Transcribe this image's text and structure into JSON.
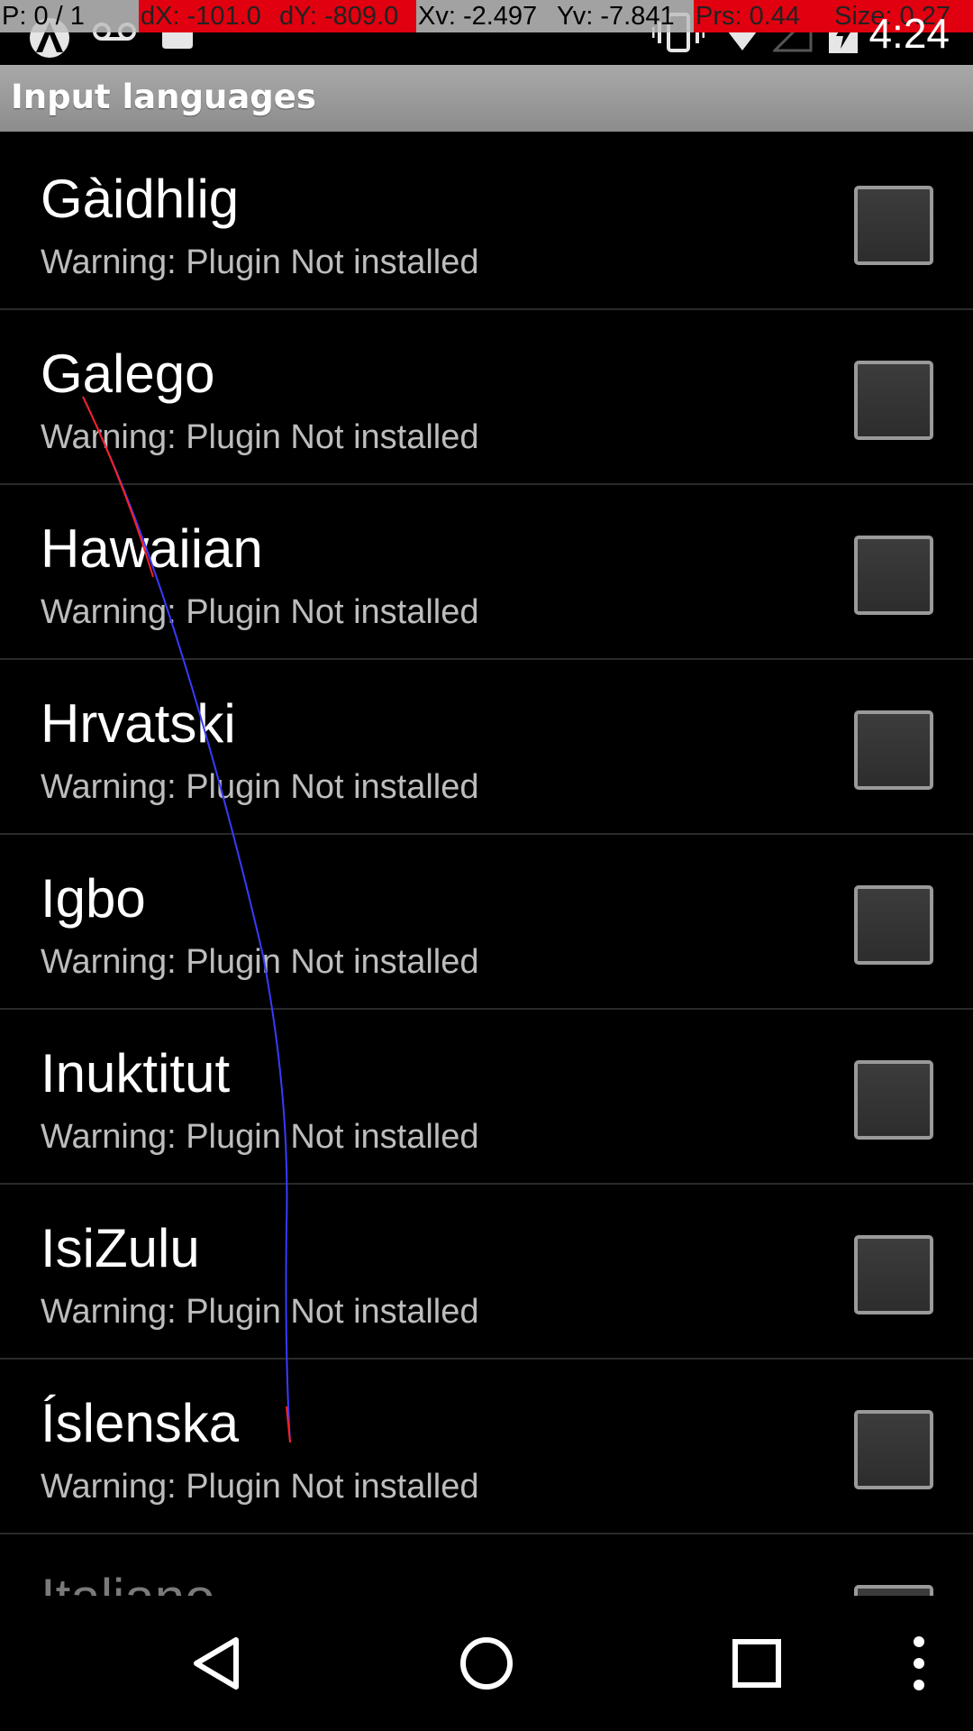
{
  "debug": {
    "pointer": "P: 0 / 1",
    "dx": "dX: -101.0",
    "dy": "dY: -809.0",
    "xv": "Xv: -2.497",
    "yv": "Yv: -7.841",
    "prs": "Prs: 0.44",
    "size": "Size: 0.27"
  },
  "status_bar": {
    "time": "4:24",
    "icons": [
      "android-icon",
      "voicemail-icon",
      "sd-card-icon",
      "vibrate-icon",
      "wifi-icon",
      "signal-icon",
      "battery-charging-icon"
    ]
  },
  "title_bar": {
    "title": "Input languages"
  },
  "languages": [
    {
      "name": "Gàidhlig",
      "summary": "Warning: Plugin Not installed",
      "checked": false
    },
    {
      "name": "Galego",
      "summary": "Warning: Plugin Not installed",
      "checked": false
    },
    {
      "name": "Hawaiian",
      "summary": "Warning: Plugin Not installed",
      "checked": false
    },
    {
      "name": "Hrvatski",
      "summary": "Warning: Plugin Not installed",
      "checked": false
    },
    {
      "name": "Igbo",
      "summary": "Warning: Plugin Not installed",
      "checked": false
    },
    {
      "name": "Inuktitut",
      "summary": "Warning: Plugin Not installed",
      "checked": false
    },
    {
      "name": "IsiZulu",
      "summary": "Warning: Plugin Not installed",
      "checked": false
    },
    {
      "name": "Íslenska",
      "summary": "Warning: Plugin Not installed",
      "checked": false
    },
    {
      "name": "Italiano",
      "summary": "",
      "checked": false
    }
  ],
  "nav_bar": {
    "icons": [
      "back-icon",
      "home-icon",
      "recents-icon",
      "overflow-menu-icon"
    ]
  },
  "colors": {
    "background": "#000000",
    "title_bar": "#9a9a9a",
    "summary_text": "#bdbdbd",
    "debug_alert": "#e1000f",
    "trace_blue": "#3a3aff",
    "trace_red": "#ff2020"
  }
}
